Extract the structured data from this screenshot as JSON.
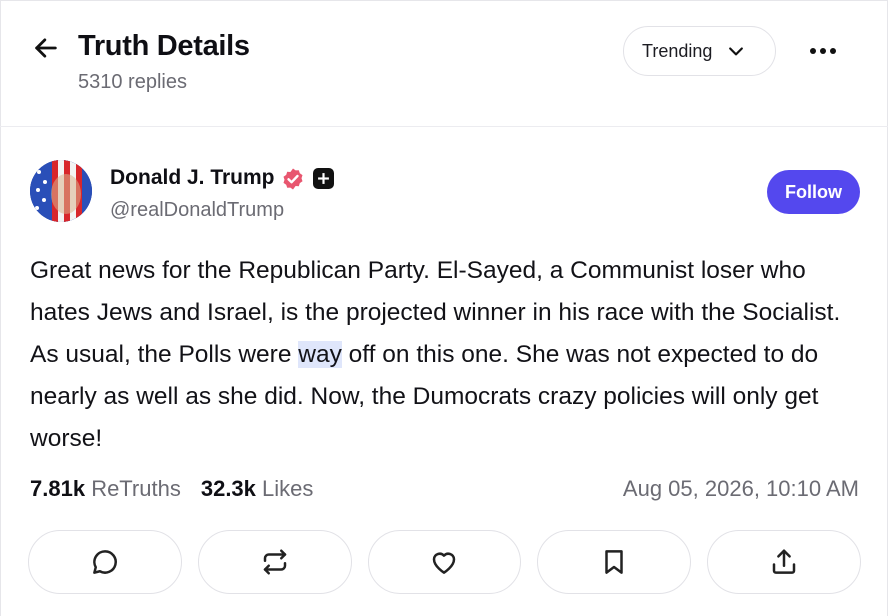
{
  "header": {
    "title": "Truth Details",
    "replies": "5310 replies",
    "sort_label": "Trending",
    "back_icon": "arrow-left-icon",
    "more_icon": "more-horizontal-icon"
  },
  "author": {
    "name": "Donald J. Trump",
    "handle": "@realDonaldTrump",
    "verified_icon": "verified-badge-icon",
    "follow_label": "Follow",
    "accent": "#5448ee"
  },
  "post": {
    "text_before": "Great news for the Republican Party. El-Sayed, a Communist loser who hates Jews and Israel, is the projected winner in his race with the Socialist. As usual, the Polls were ",
    "highlighted": "way",
    "text_after": " off on this one. She was not expected to do nearly as well as she did. Now, the Dumocrats crazy policies will only get worse!"
  },
  "stats": {
    "retruths_count": "7.81k",
    "retruths_label": "ReTruths",
    "likes_count": "32.3k",
    "likes_label": "Likes",
    "timestamp": "Aug 05, 2026, 10:10 AM"
  },
  "actions": [
    "reply-icon",
    "retruth-icon",
    "like-icon",
    "bookmark-icon",
    "share-icon"
  ]
}
